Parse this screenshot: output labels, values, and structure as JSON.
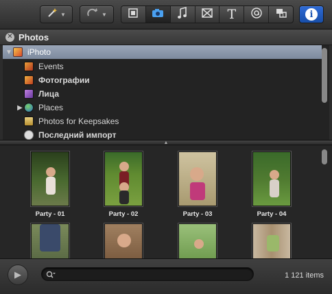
{
  "toolbar": {
    "left_buttons": [
      {
        "icon": "magic-wand-icon"
      },
      {
        "icon": "rotate-icon"
      }
    ],
    "segments": [
      {
        "icon": "filmstrip-icon",
        "active": false
      },
      {
        "icon": "camera-icon",
        "active": true
      },
      {
        "icon": "music-note-icon",
        "active": false
      },
      {
        "icon": "transition-icon",
        "active": false
      },
      {
        "icon": "title-text-icon",
        "glyph": "T",
        "active": false
      },
      {
        "icon": "globe-map-icon",
        "active": false
      },
      {
        "icon": "theme-icon",
        "active": false
      }
    ],
    "info_glyph": "i",
    "accent": "#1f5cc8"
  },
  "panel": {
    "close_glyph": "✕",
    "title": "Photos"
  },
  "source_list": {
    "items": [
      {
        "label": "iPhoto",
        "level": 0,
        "disclosure": "▼",
        "icon": "iphoto-icon",
        "selected": true,
        "bold": false
      },
      {
        "label": "Events",
        "level": 1,
        "disclosure": "",
        "icon": "events-icon",
        "selected": false,
        "bold": false
      },
      {
        "label": "Фотографии",
        "level": 1,
        "disclosure": "",
        "icon": "photos-icon",
        "selected": false,
        "bold": true
      },
      {
        "label": "Лица",
        "level": 1,
        "disclosure": "",
        "icon": "faces-icon",
        "selected": false,
        "bold": true
      },
      {
        "label": "Places",
        "level": 1,
        "disclosure": "▶",
        "icon": "globe-icon",
        "selected": false,
        "bold": false
      },
      {
        "label": "Photos for Keepsakes",
        "level": 1,
        "disclosure": "",
        "icon": "album-icon",
        "selected": false,
        "bold": false
      },
      {
        "label": "Последний импорт",
        "level": 1,
        "disclosure": "",
        "icon": "last-import-icon",
        "selected": false,
        "bold": true
      }
    ]
  },
  "photos": {
    "rows": [
      [
        {
          "caption": "Party - 01",
          "bg": "#3d5a2c",
          "dress": "#e8e0d8"
        },
        {
          "caption": "Party - 02",
          "bg": "#4d7a2a",
          "dress": "#7a1f25"
        },
        {
          "caption": "Party - 03",
          "bg": "#b7a37a",
          "dress": "#c03a7a"
        },
        {
          "caption": "Party - 04",
          "bg": "#5f8a3a",
          "dress": "#d8d0c8"
        }
      ],
      [
        {
          "caption": "",
          "bg": "#6b7a4a",
          "dress": "#3a4a6a"
        },
        {
          "caption": "",
          "bg": "#8a6a4a",
          "dress": "#a05a5a"
        },
        {
          "caption": "",
          "bg": "#8ab06a",
          "dress": "#c8a8a8"
        },
        {
          "caption": "",
          "bg": "#b8a890",
          "dress": "#9ab86a"
        }
      ]
    ]
  },
  "bottom": {
    "play_glyph": "▶",
    "search_placeholder": "",
    "item_count": "1 121 items"
  }
}
